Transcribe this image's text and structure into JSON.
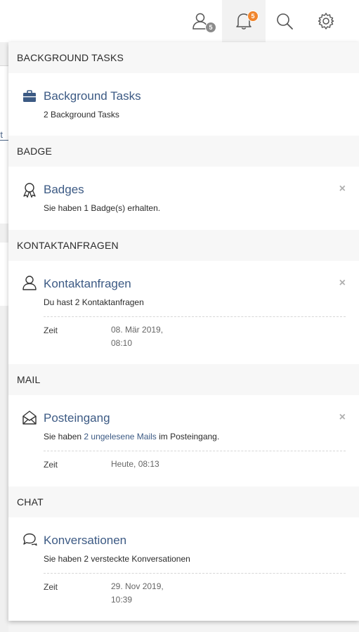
{
  "topbar": {
    "contacts_badge": "5",
    "notifications_badge": "5"
  },
  "background_page": {
    "partial_link": "rt"
  },
  "notifications": {
    "background_tasks": {
      "heading": "BACKGROUND TASKS",
      "title": "Background Tasks",
      "message": "2 Background Tasks"
    },
    "badge": {
      "heading": "BADGE",
      "title": "Badges",
      "message": "Sie haben 1 Badge(s) erhalten.",
      "close": "×"
    },
    "contacts": {
      "heading": "KONTAKTANFRAGEN",
      "title": "Kontaktanfragen",
      "message": "Du hast 2 Kontaktanfragen",
      "close": "×",
      "time_label": "Zeit",
      "time_line1": "08. Mär 2019,",
      "time_line2": "08:10"
    },
    "mail": {
      "heading": "MAIL",
      "title": "Posteingang",
      "message_pre": "Sie haben ",
      "message_link": "2 ungelesene Mails",
      "message_post": " im Posteingang.",
      "close": "×",
      "time_label": "Zeit",
      "time_line1": "Heute, 08:13"
    },
    "chat": {
      "heading": "CHAT",
      "title": "Konversationen",
      "message": "Sie haben 2 versteckte Konversationen",
      "time_label": "Zeit",
      "time_line1": "29. Nov 2019,",
      "time_line2": "10:39"
    }
  },
  "colors": {
    "accent": "#3c5a84",
    "notification_badge": "#f0852d",
    "contacts_badge": "#8b8b8b"
  }
}
